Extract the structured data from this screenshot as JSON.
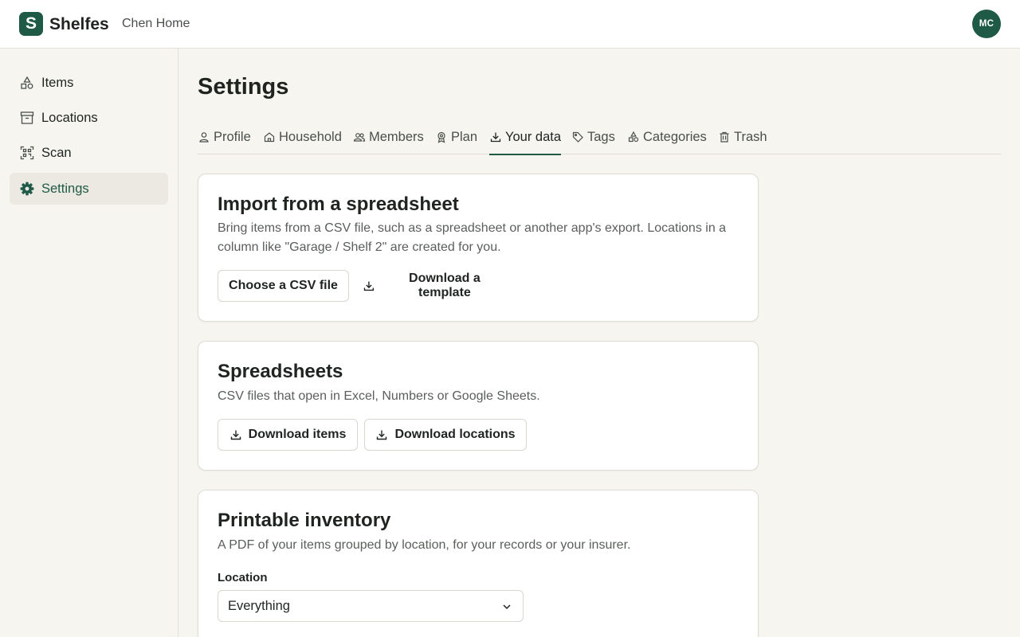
{
  "app": {
    "brand": "Shelfes",
    "logo_letter": "S",
    "household": "Chen Home",
    "user_initials": "MC",
    "accent_color": "#1f5a47"
  },
  "sidebar": {
    "items": [
      {
        "label": "Items",
        "icon": "shapes-icon"
      },
      {
        "label": "Locations",
        "icon": "archive-box-icon"
      },
      {
        "label": "Scan",
        "icon": "scan-icon"
      },
      {
        "label": "Settings",
        "icon": "gear-icon",
        "active": true
      }
    ]
  },
  "page": {
    "title": "Settings",
    "tabs": [
      {
        "label": "Profile",
        "icon": "user-icon"
      },
      {
        "label": "Household",
        "icon": "home-icon"
      },
      {
        "label": "Members",
        "icon": "users-icon"
      },
      {
        "label": "Plan",
        "icon": "badge-icon"
      },
      {
        "label": "Your data",
        "icon": "download-icon",
        "active": true
      },
      {
        "label": "Tags",
        "icon": "tag-icon"
      },
      {
        "label": "Categories",
        "icon": "shapes-icon"
      },
      {
        "label": "Trash",
        "icon": "trash-icon"
      }
    ]
  },
  "import_card": {
    "title": "Import from a spreadsheet",
    "description": "Bring items from a CSV file, such as a spreadsheet or another app's export. Locations in a column like \"Garage / Shelf 2\" are created for you.",
    "choose_button": "Choose a CSV file",
    "template_button": "Download a template"
  },
  "spreadsheets_card": {
    "title": "Spreadsheets",
    "description": "CSV files that open in Excel, Numbers or Google Sheets.",
    "items_button": "Download items",
    "locations_button": "Download locations"
  },
  "printable_card": {
    "title": "Printable inventory",
    "description": "A PDF of your items grouped by location, for your records or your insurer.",
    "location_label": "Location",
    "location_value": "Everything"
  }
}
